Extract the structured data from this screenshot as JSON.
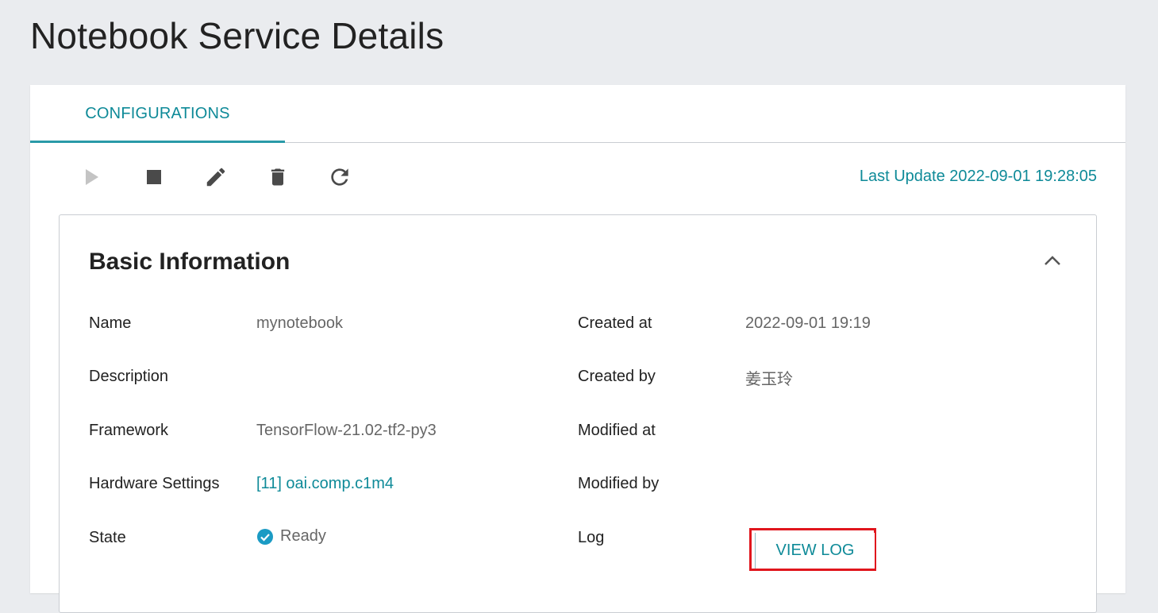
{
  "page": {
    "title": "Notebook Service Details"
  },
  "tabs": [
    {
      "label": "CONFIGURATIONS",
      "active": true
    }
  ],
  "toolbar": {
    "actions": [
      {
        "icon": "play-icon",
        "enabled": false
      },
      {
        "icon": "stop-icon",
        "enabled": true
      },
      {
        "icon": "edit-icon",
        "enabled": true
      },
      {
        "icon": "delete-icon",
        "enabled": true
      },
      {
        "icon": "refresh-icon",
        "enabled": true
      }
    ],
    "last_update": "Last Update 2022-09-01 19:28:05"
  },
  "basic_info": {
    "title": "Basic Information",
    "collapse_icon": "chevron-up-icon",
    "left": [
      {
        "label": "Name",
        "value": "mynotebook"
      },
      {
        "label": "Description",
        "value": ""
      },
      {
        "label": "Framework",
        "value": "TensorFlow-21.02-tf2-py3"
      },
      {
        "label": "Hardware Settings",
        "value": "[11] oai.comp.c1m4"
      },
      {
        "label": "State",
        "value": "Ready",
        "icon": "check-circle-icon"
      }
    ],
    "right": [
      {
        "label": "Created at",
        "value": "2022-09-01 19:19"
      },
      {
        "label": "Created by",
        "value": "姜玉玲"
      },
      {
        "label": "Modified at",
        "value": ""
      },
      {
        "label": "Modified by",
        "value": ""
      },
      {
        "label": "Log",
        "button": "VIEW LOG"
      }
    ]
  },
  "colors": {
    "accent": "#0e8a98",
    "highlight_box": "#e0161d",
    "background": "#eaecef",
    "ready_icon": "#1b9bc4"
  }
}
